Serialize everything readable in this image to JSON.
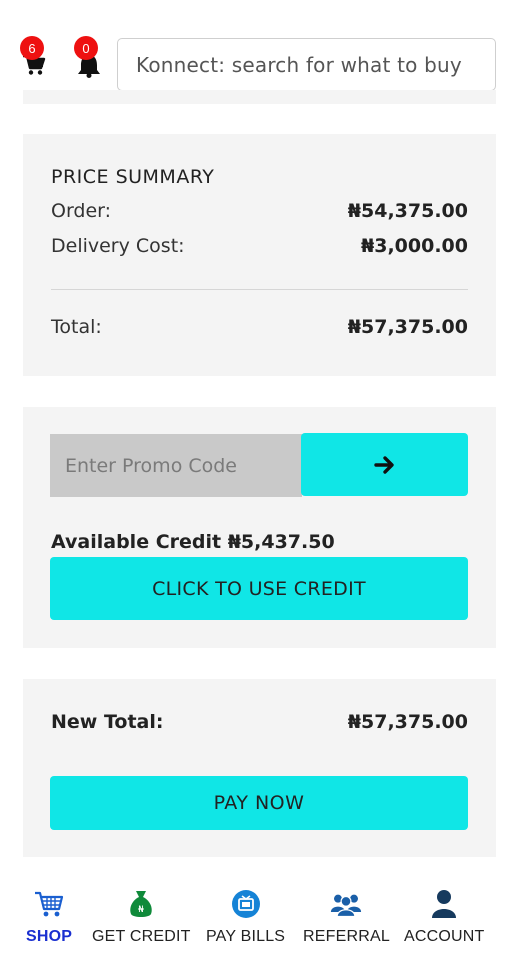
{
  "header": {
    "cart_count": "6",
    "notification_count": "0",
    "search_placeholder": "Konnect: search for what to buy"
  },
  "price_summary": {
    "title": "PRICE SUMMARY",
    "order_label": "Order:",
    "order_value": "₦54,375.00",
    "delivery_label": "Delivery Cost:",
    "delivery_value": "₦3,000.00",
    "total_label": "Total:",
    "total_value": "₦57,375.00"
  },
  "promo": {
    "placeholder": "Enter Promo Code",
    "submit_icon": "arrow-right-icon",
    "available_credit": "Available Credit ₦5,437.50",
    "use_credit_label": "CLICK TO USE CREDIT"
  },
  "final": {
    "new_total_label": "New Total:",
    "new_total_value": "₦57,375.00",
    "pay_label": "PAY NOW"
  },
  "bottom_nav": {
    "items": [
      {
        "label": "SHOP",
        "icon": "cart-icon",
        "active": true
      },
      {
        "label": "GET CREDIT",
        "icon": "money-bag-icon",
        "active": false
      },
      {
        "label": "PAY BILLS",
        "icon": "pay-bills-icon",
        "active": false
      },
      {
        "label": "REFERRAL",
        "icon": "referral-icon",
        "active": false
      },
      {
        "label": "ACCOUNT",
        "icon": "account-icon",
        "active": false
      }
    ]
  },
  "colors": {
    "accent": "#10e6e6",
    "badge": "#ee1111",
    "active_nav": "#1a2fd0",
    "card_bg": "#f4f4f4"
  }
}
